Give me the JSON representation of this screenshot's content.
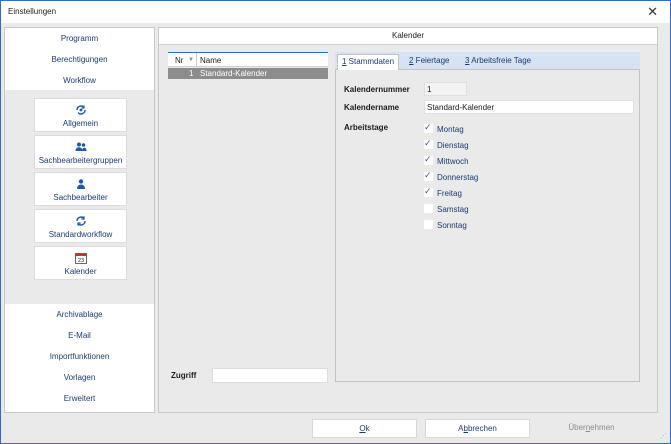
{
  "window": {
    "title": "Einstellungen",
    "close_icon": "close-icon"
  },
  "nav": {
    "top": [
      {
        "label": "Programm"
      },
      {
        "label": "Berechtigungen"
      },
      {
        "label": "Workflow"
      }
    ],
    "tiles": [
      {
        "label": "Allgemein",
        "icon": "refresh-gear-icon"
      },
      {
        "label": "Sachbearbeitergruppen",
        "icon": "users-group-icon"
      },
      {
        "label": "Sachbearbeiter",
        "icon": "user-icon"
      },
      {
        "label": "Standardworkflow",
        "icon": "sync-icon"
      },
      {
        "label": "Kalender",
        "icon": "calendar-icon",
        "icon_text": "23"
      }
    ],
    "bottom": [
      {
        "label": "Archivablage"
      },
      {
        "label": "E-Mail"
      },
      {
        "label": "Importfunktionen"
      },
      {
        "label": "Vorlagen"
      },
      {
        "label": "Erweitert"
      }
    ]
  },
  "main": {
    "header": "Kalender",
    "list": {
      "columns": {
        "nr": "Nr",
        "name": "Name"
      },
      "rows": [
        {
          "nr": "1",
          "name": "Standard-Kalender"
        }
      ]
    },
    "zugriff": {
      "label": "Zugriff",
      "value": ""
    },
    "tabs": [
      {
        "key": "1",
        "label": " Stammdaten",
        "active": true
      },
      {
        "key": "2",
        "label": " Feiertage",
        "active": false
      },
      {
        "key": "3",
        "label": " Arbeitsfreie Tage",
        "active": false
      }
    ],
    "form": {
      "kalendernummer_label": "Kalendernummer",
      "kalendernummer_value": "1",
      "kalendername_label": "Kalendername",
      "kalendername_value": "Standard-Kalender",
      "arbeitstage_label": "Arbeitstage",
      "days": [
        {
          "label": "Montag",
          "checked": true
        },
        {
          "label": "Dienstag",
          "checked": true
        },
        {
          "label": "Mittwoch",
          "checked": true
        },
        {
          "label": "Donnerstag",
          "checked": true
        },
        {
          "label": "Freitag",
          "checked": true
        },
        {
          "label": "Samstag",
          "checked": false
        },
        {
          "label": "Sonntag",
          "checked": false
        }
      ]
    }
  },
  "buttons": {
    "ok_key": "O",
    "ok_rest": "k",
    "abbrechen_pre": "A",
    "abbrechen_key": "b",
    "abbrechen_rest": "brechen",
    "uebernehmen_pre": "Über",
    "uebernehmen_key": "n",
    "uebernehmen_rest": "ehmen"
  },
  "colors": {
    "accent": "#2b6cd6",
    "selected_row": "#8c8c8c",
    "tabbar": "#d6e3f4",
    "link_text": "#1c3b70"
  }
}
